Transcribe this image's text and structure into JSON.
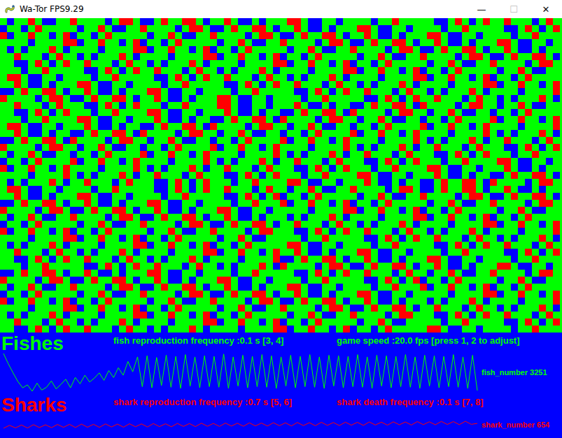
{
  "window": {
    "title": "Wa-Tor FPS9.29",
    "controls": [
      {
        "label": "—",
        "disabled": false
      },
      {
        "label": "☐",
        "disabled": true
      },
      {
        "label": "✕",
        "disabled": false
      }
    ]
  },
  "grid": {
    "rows": [
      ".f..s.ff..s....f.ss.ff.s..ss.f..s.ff.f...ss.ff..f....f..s.....ff.s.f.s..s...f.s.",
      "f..f.s.....f..s.ff..s....f.ss.ff.s..ss.f..s.ff.f...ss.ff..f....f..s.....ff.s.f.s",
      "sf..s..f.sf..f.s.....f..s.ff..s....f.ss.ff.s..ss.f..s.ff.f...ss.ff..f....f..s...",
      "....f....ssf..s..f.sf..f.s.....f..s.ff..s....f.ss.ff.s..ss.f..s.ff.f...ss.ff..f.",
      ".f.f...s.f....f....ssf..s..f.sf..f.s.....f..s.ff..s....f.ss.ff.s..ss.f..s.ff.f..",
      "..s...f.s..f.f...s.f....f....ssf..s..f.sf..f.s.....f..s.ff..s....f.ss.ff.s..ss.f",
      "..ff.s.f.s..s...f.s..f.f...s.f....f....ssf..s..f.sf..f.s.....f..s.ff..s....f.ss.",
      "...f..s.....ff.s.f.s..s...f.s..f.f...s.f....f....ssf..s..f.sf..f.s.....f..s.ff..",
      ".ss.ff..f....f..s.....ff.s.f.s..s...f.s..f.f...s.f....f....ssf..s..f.sf..f.s....",
      "..s.ff.f...ss.ff..f....f..s.....ff.s.f.s..s...f.s..f.f...s.f....f....ssf..s..f.s",
      "ff.s..ss.f..s.ff.f...ss.ff..f....f..s.....ff.s.f.s..s...f.s..f.f...s.f....f....s",
      "s....f.ss.ff.s..ss.f..s.ff.f...ss.ff..f....f..s.....ff.s.f.s..s...f.s..f.f...s.f",
      "..s...f.s...ff.s.f.s...f..s....ss.ff..f...s.ff.f..ff.s..ss.fs....f.ss..f..s.ff..",
      "..ff.s.f.s...f..s....ss.ff..f...s.ff.f..ff.s..ss.fs....f.ss..f..s.ff..f..f.s....",
      "...f..s....ss.ff..f...s.ff.f..ff.s..ss.fs....f.ss..f..s.ff..f..f.s....sf..s..f.s",
      ".ss.ff..f...s.ff.f..ff.s..ss.fs....f.ss..f..s.ff..f..f.s....sf..s..f.s....f....s",
      "..s.ff.f..ff.s..ss.fs....f.ss..f..s.ff..f..f.s....sf..s..f.s....f....s.f.f...s.f",
      "ff.s..ss.fs....f.ss..f..s.ff..f..f.s....sf..s..f.s....f....s.f.f...s.f..s...f.s.",
      "s....f.ss..f..s.ff..f..f.s....sf..s..f.s....f....s.f.f...s.f..s...f.s...ff.s.f.s",
      ".f..s.ff..f..f.s....sf..s..f.s....f....s.f.f...s.f..s...f.s...ff.s.f.s...f..s...",
      "f..f.s....sf..s..f.s....f....s.f.f...s.f..s...f.s...ff.s.f.s...f..s....ss.ff..f.",
      "sf..s..f.s....f....s.f.f...s.f..s...f.s...ff.s.f.s...f..s....ss.ff..f...s.ff.f..",
      "....f....s.f.f...s.f..s...f.s...ff.s.f.s...f..s....ss.ff..f...s.ff.f..ff.s..ss.f",
      ".f.f...s.f..s...f.s...ff.s.f.s...f..s....ss.ff..f...s.ff.f..ff.s..ss.fs....f.ss.",
      ".ss.ff..f....f..s.....ff.s.f.s..s...f.s..f..s.ff..s....f.ss.ff.s..ss.f..s.ff.f..",
      "..s.ff.f...ss.ff..f....f..s.....ff.s.f.sf..f.s.....f..s.ff..s....f.ss.ff.s..ss.f",
      "ff.s..ss.f..s.ff.f...ss.ff..f....f..s...sf..s..f.sf..f.s.....f..s.ff..s....f.ss.",
      "s....f.ss.ff.s..ss.f..s.ff.f...ss.ff..f.....f....ssf..s..f.sf..f.s.....f..s.ff..",
      ".f..s.ff..s....f.ss.ff.s..ss.f..s.ff.f...f.f...s.f....f....ssf..s..f.sf..f.s....",
      "f..f.s.....f..s.ff..s....f.ss.ff.s..ss.f..s...f.s..f.f...s.f....f....ssf..s..f.s",
      "sf..s..f.sf..f.s.....f..s.ff..s....f.ss...ff.s.f.s..s...f.s..f.f...s.f....f....s",
      "....f....ssf..s..f.sf..f.s.....f..s.ff.....f..s.....ff.s.f.s..s...f.s..f.f...s.f",
      ".f.f...s.f....f....ssf..s..f.sf..f.s.....ss.ff..f....f..s.....ff.s.f.s..s...f.s.",
      "..s...f.s..f.f...s.f....f....ssf..s..f.s..s.ff.f...ss.ff..f....f..s.....ff.s.f.s",
      "..ff.s.f.s..s...f.s..f.f...s.f....f....sff.s..ss.f..s.ff.f...ss.ff..f....f..s...",
      "...f..s.....ff.s.f.s..s...f.s..f.f...s.fs....f.ss.ff.s..ss.f..s.ff.f...ss.ff..f.",
      "ff.s..ss.f..s.ff.f...ss.ff..f....f..s.....ff.s.f.s..s...f.s..f..s.ff..s....f.ss.",
      "s....f.ss.ff.s..ss.f..s.ff.f...ss.ff..f....f..s.....ff.s.f.sf..f.s.....f..s.ff..",
      ".f..s.ff..s....f.ss.ff.s..ss.f..s.ff.f...ss.ff..f....f..s...sf..s..f.sf..f.s....",
      "f..f.s.....f..s.ff..s....f.ss.ff.s..ss.f..s.ff.f...ss.ff..f.....f....ssf..s..f.s",
      "sf..s..f.sf..f.s.....f..s.ff..s....f.ss.ff.s..ss.f..s.ff.f...f.f...s.f....f....s",
      "....f....ssf..s..f.sf..f.s.....f..s.ff..s....f.ss.ff.s..ss.f..s...f.s..f.f...s.f",
      ".f.f...s.f....f....ssf..s..f.sf..f.s.....f..s.ff..s....f.ss...ff.s.f.s..s...f.s.",
      "..s...f.s..f.f...s.f....f....ssf..s..f.sf..f.s.....f..s.ff.....f..s.....ff.s.f.s",
      "..ff.s.f.s..s...f.s..f.f...s.f....f....ssf..s..f.sf..f.s.....ss.ff..f....f..s..."
    ]
  },
  "panel": {
    "fish": {
      "heading": "Fishes",
      "info": "fish reproduction frequency :0.1 s [3, 4]",
      "speed": "game speed :20.0 fps [press 1, 2 to adjust]",
      "count": "fish_number 3251",
      "series": [
        3900,
        3720,
        3560,
        3410,
        3300,
        3350,
        3240,
        3380,
        3260,
        3310,
        3420,
        3280,
        3360,
        3450,
        3300,
        3480,
        3370,
        3520,
        3400,
        3470,
        3560,
        3430,
        3600,
        3480,
        3650,
        3520,
        3760,
        3580,
        3840,
        3320,
        3860,
        3300,
        3830,
        3340,
        3870,
        3310,
        3850,
        3290,
        3880,
        3330,
        3840,
        3300,
        3860,
        3320,
        3850,
        3310,
        3890,
        3290,
        3840,
        3330,
        3870,
        3300,
        3850,
        3320,
        3880,
        3310,
        3860,
        3290,
        3840,
        3330,
        3870,
        3300,
        3850,
        3320,
        3880,
        3310,
        3840,
        3290,
        3870,
        3330,
        3860,
        3300,
        3850,
        3320,
        3880,
        3310,
        3840,
        3290,
        3870,
        3330,
        3860,
        3300,
        3850,
        3320,
        3880,
        3310,
        3840,
        3290,
        3870,
        3330,
        3860,
        3300,
        3850,
        3320,
        3880,
        3310,
        3840,
        3290,
        3870,
        3251
      ]
    },
    "shark": {
      "heading": "Sharks",
      "info": "shark reproduction frequency :0.7 s [5, 6]",
      "death": "shark death frequency :0.1 s [7, 8]",
      "count": "shark_number 654",
      "series": [
        520,
        600,
        530,
        610,
        525,
        620,
        540,
        615,
        535,
        625,
        545,
        630,
        540,
        635,
        550,
        630,
        545,
        640,
        555,
        635,
        550,
        645,
        560,
        640,
        555,
        650,
        565,
        645,
        560,
        655,
        570,
        650,
        565,
        660,
        575,
        655,
        570,
        665,
        580,
        660,
        575,
        670,
        585,
        665,
        580,
        675,
        590,
        670,
        585,
        680,
        595,
        675,
        590,
        685,
        600,
        680,
        595,
        690,
        605,
        685,
        600,
        695,
        610,
        690,
        605,
        700,
        615,
        695,
        610,
        705,
        620,
        700,
        615,
        710,
        625,
        705,
        620,
        715,
        630,
        654
      ]
    }
  }
}
